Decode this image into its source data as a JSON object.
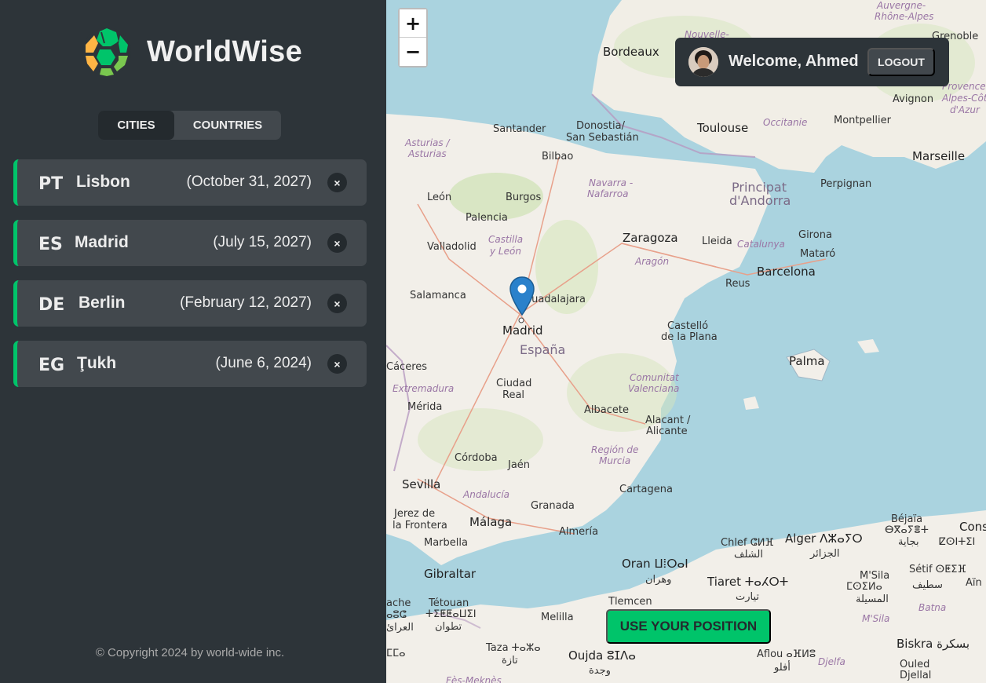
{
  "app": {
    "name": "WorldWise"
  },
  "tabs": {
    "cities": "CITIES",
    "countries": "COUNTRIES"
  },
  "cities": [
    {
      "code": "PT",
      "name": "Lisbon",
      "date": "(October 31, 2027)"
    },
    {
      "code": "ES",
      "name": "Madrid",
      "date": "(July 15, 2027)"
    },
    {
      "code": "DE",
      "name": "Berlin",
      "date": "(February 12, 2027)"
    },
    {
      "code": "EG",
      "name": "Ţukh",
      "date": "(June 6, 2024)"
    }
  ],
  "delete_symbol": "×",
  "footer": {
    "copyright": "© Copyright 2024 by world-wide inc."
  },
  "map": {
    "zoom_in": "+",
    "zoom_out": "−",
    "use_position": "USE YOUR POSITION",
    "labels": {
      "bordeaux": "Bordeaux",
      "toulouse": "Toulouse",
      "montpellier": "Montpellier",
      "marseille": "Marseille",
      "avignon": "Avignon",
      "grenoble": "Grenoble",
      "nouvelle": "Nouvelle-",
      "auvergne": "Auvergne-",
      "rhone_alpes": "Rhône-Alpes",
      "occitanie": "Occitanie",
      "provence": "Provence-",
      "alpes_cote": "Alpes-Côte",
      "dazur": "d'Azur",
      "santander": "Santander",
      "donostia": "Donostia/",
      "san_sebastian": "San Sebastián",
      "bilbao": "Bilbao",
      "asturias": "Asturias /",
      "asturias2": "Asturias",
      "navarra": "Navarra -",
      "nafarroa": "Nafarroa",
      "principat": "Principat",
      "dandorra": "d'Andorra",
      "perpignan": "Perpignan",
      "leon": "León",
      "burgos": "Burgos",
      "palencia": "Palencia",
      "zaragoza": "Zaragoza",
      "lleida": "Lleida",
      "girona": "Girona",
      "castilla": "Castilla",
      "y_leon": "y León",
      "valladolid": "Valladolid",
      "aragon": "Aragón",
      "catalunya": "Catalunya",
      "mataro": "Mataró",
      "barcelona": "Barcelona",
      "reus": "Reus",
      "salamanca": "Salamanca",
      "guadalajara": "Guadalajara",
      "madrid": "Madrid",
      "espana": "España",
      "castello": "Castelló",
      "de_la_plana": "de la Plana",
      "palma": "Palma",
      "caceres": "Cáceres",
      "extremadura": "Extremadura",
      "ciudad": "Ciudad",
      "real": "Real",
      "comunitat": "Comunitat",
      "valenciana": "Valenciana",
      "merida": "Mérida",
      "albacete": "Albacete",
      "alacant": "Alacant /",
      "alicante": "Alicante",
      "cordoba": "Córdoba",
      "jaen": "Jaén",
      "region": "Región de",
      "murcia": "Murcia",
      "sevilla": "Sevilla",
      "andalucia": "Andalucía",
      "granada": "Granada",
      "cartagena": "Cartagena",
      "jerez": "Jerez de",
      "la_frontera": "la Frontera",
      "malaga": "Málaga",
      "almeria": "Almería",
      "marbella": "Marbella",
      "gibraltar": "Gibraltar",
      "oran": "Oran ⵡⵂⵔⴰⵏ",
      "oran_ar": "وهران",
      "chlef": "Chlef ⵛⵍⴼ",
      "chlef_ar": "الشلف",
      "alger": "Alger ⴷⵣⴰⵢⵔ",
      "alger_ar": "الجزائر",
      "tiaret": "Tiaret ⵜⴰⵃⵔⵜ",
      "tiaret_ar": "تيارت",
      "bejaia": "Béjaïa",
      "bejaia_tz": "ⴱⴳⴰⵢⴻⵜ",
      "bejaia_ar": "بجاية",
      "constantine": "Const",
      "constantine_tz": "ⵇⵙⵏⵜⵉⵏ",
      "msila": "M'Sila",
      "msila_tz": "ⵎⵙⵉⵍⴰ",
      "msila_ar": "المسيلة",
      "setif": "Sétif ⵙⵟⵉⴼ",
      "setif_ar": "سطيف",
      "batna": "Batna",
      "ain": "Aïn",
      "msila2": "M'Sila",
      "biskra": "Biskra بسكرة",
      "ouled": "Ouled",
      "djellal": "Djellal",
      "djelfa": "Djelfa",
      "aflou": "Aflou ⴰⴼⵍⵓ",
      "aflou_ar": "أفلو",
      "tlemcen": "Tlemcen",
      "melilla": "Melilla",
      "oujda": "Oujda ⵓⵊⴷⴰ",
      "oujda_ar": "وجدة",
      "taza": "Taza ⵜⴰⵣⴰ",
      "taza_ar": "تازة",
      "tetouan": "Tétouan",
      "tetouan_tz": "ⵜⵉⵟⵟⴰⵡⵉⵏ",
      "tetouan_ar": "تطوان",
      "fes": "Fès-Meknès",
      "ache": "ache",
      "oc": "ⴰⵓⵛ",
      "ar": "العرائ",
      "ma": "ⵎⵎⴰ"
    }
  },
  "user": {
    "welcome": "Welcome, Ahmed",
    "logout": "LOGOUT"
  },
  "colors": {
    "accent": "#00c46a",
    "sidebar": "#2d3439",
    "item": "#42484d",
    "sea": "#aad3df",
    "land": "#f2efe9",
    "pin": "#2a81cb"
  }
}
